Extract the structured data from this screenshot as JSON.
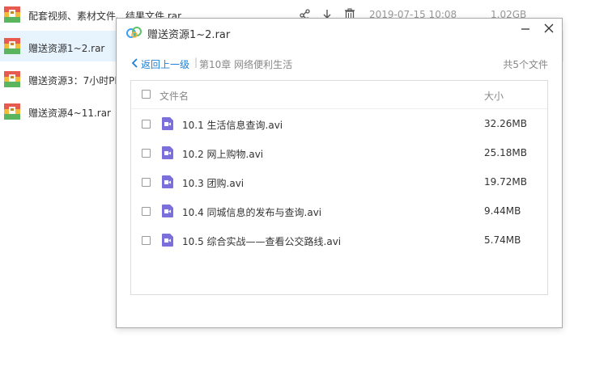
{
  "background_list": {
    "rows": [
      {
        "name": "配套视频、素材文件、结果文件.rar",
        "date": "2019-07-15 10:08",
        "size": "1.02GB"
      },
      {
        "name": "赠送资源1~2.rar",
        "date": "",
        "size": ""
      },
      {
        "name": "赠送资源3：7小时Ph",
        "date": "",
        "size": ""
      },
      {
        "name": "赠送资源4~11.rar",
        "date": "",
        "size": ""
      }
    ],
    "icon": "rar-archive-icon",
    "highlight_color": "#e7f3fd"
  },
  "dialog": {
    "title": "赠送资源1~2.rar",
    "back_label": "返回上一级",
    "separator": "|",
    "breadcrumb": "第10章 网络便利生活",
    "total": "共5个文件",
    "header": {
      "name": "文件名",
      "size": "大小"
    },
    "files": [
      {
        "name": "10.1 生活信息查询.avi",
        "size": "32.26MB"
      },
      {
        "name": "10.2 网上购物.avi",
        "size": "25.18MB"
      },
      {
        "name": "10.3 团购.avi",
        "size": "19.72MB"
      },
      {
        "name": "10.4 同城信息的发布与查询.avi",
        "size": "9.44MB"
      },
      {
        "name": "10.5 综合实战——查看公交路线.avi",
        "size": "5.74MB"
      }
    ],
    "accent_color": "#1f7fd5",
    "video_icon_color": "#7b6fdc"
  }
}
